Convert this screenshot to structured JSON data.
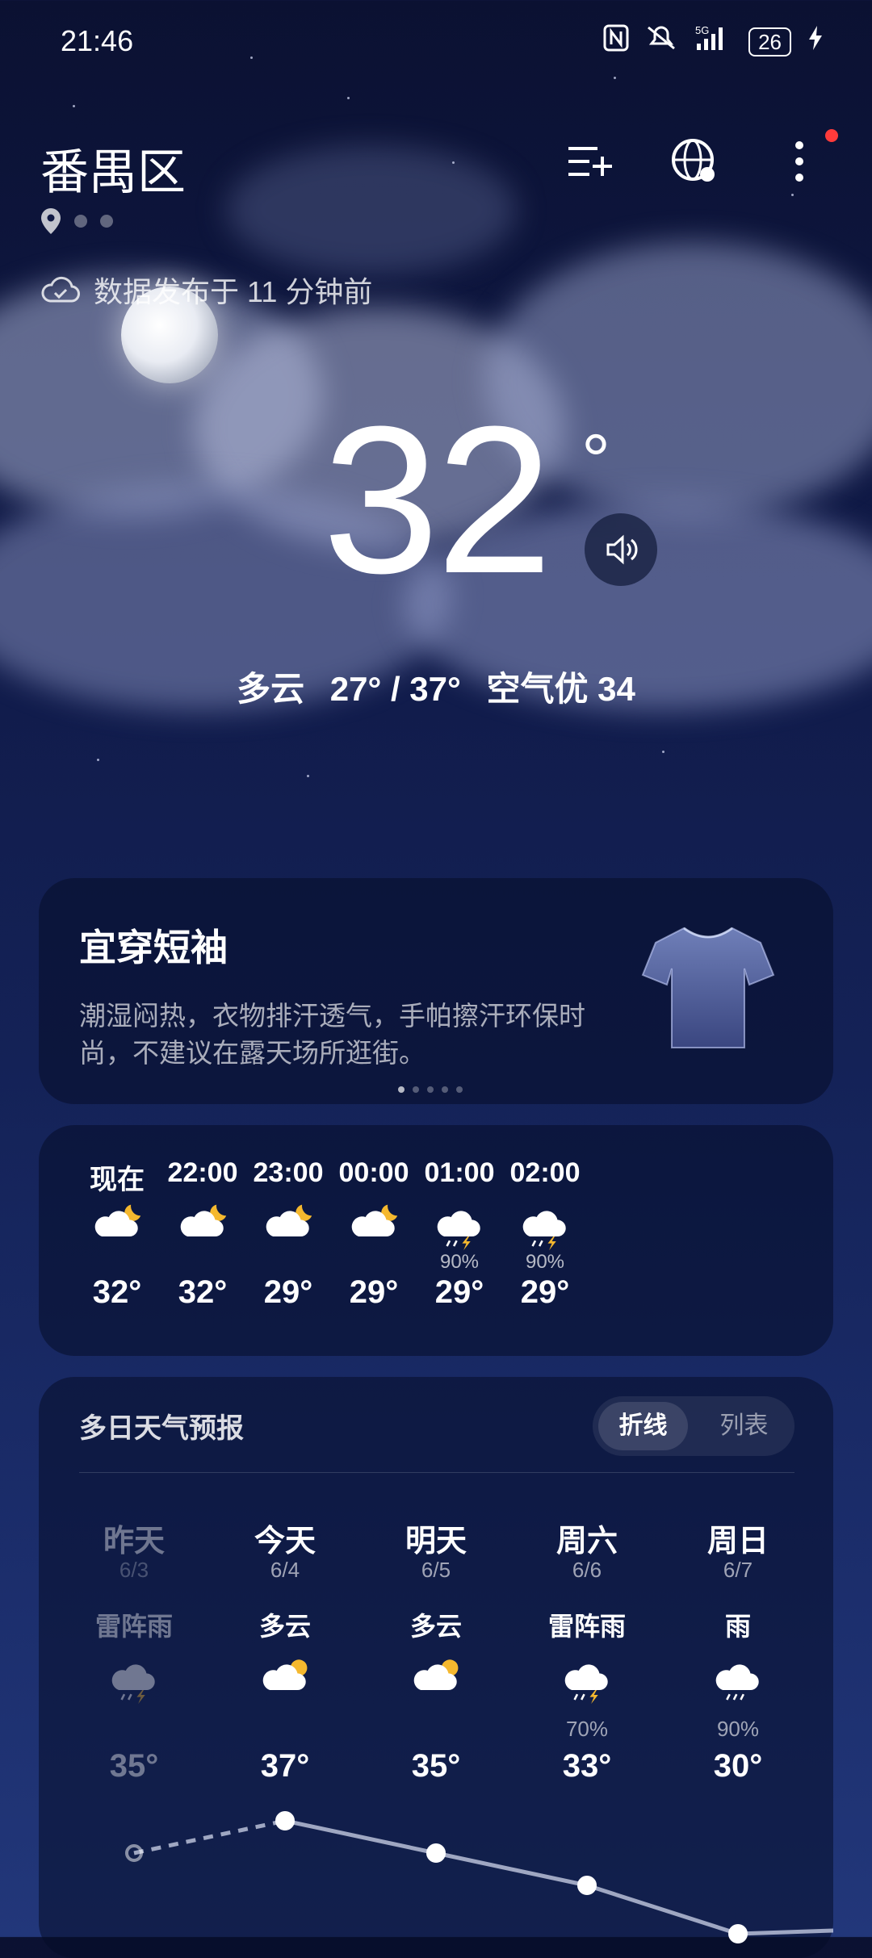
{
  "status_bar": {
    "time": "21:46",
    "battery": "26"
  },
  "header": {
    "city": "番禺区"
  },
  "published": "数据发布于 11 分钟前",
  "current": {
    "temperature": "32",
    "degree_symbol": "°",
    "condition": "多云",
    "range": "27° / 37°",
    "air_quality": "空气优 34"
  },
  "clothing_card": {
    "title": "宜穿短袖",
    "description": "潮湿闷热，衣物排汗透气，手帕擦汗环保时尚，不建议在露天场所逛街。"
  },
  "hourly": [
    {
      "time": "现在",
      "icon": "partly-cloudy-night-icon",
      "temp": "32°",
      "pop": ""
    },
    {
      "time": "22:00",
      "icon": "partly-cloudy-night-icon",
      "temp": "32°",
      "pop": ""
    },
    {
      "time": "23:00",
      "icon": "partly-cloudy-night-icon",
      "temp": "29°",
      "pop": ""
    },
    {
      "time": "00:00",
      "icon": "partly-cloudy-night-icon",
      "temp": "29°",
      "pop": ""
    },
    {
      "time": "01:00",
      "icon": "thunderstorm-icon",
      "temp": "29°",
      "pop": "90%"
    },
    {
      "time": "02:00",
      "icon": "thunderstorm-icon",
      "temp": "29°",
      "pop": "90%"
    }
  ],
  "forecast": {
    "title": "多日天气预报",
    "toggle": {
      "line": "折线",
      "list": "列表",
      "selected": "折线"
    },
    "days": [
      {
        "name": "昨天",
        "date": "6/3",
        "weather": "雷阵雨",
        "icon": "thunderstorm-icon",
        "pop": "",
        "high": "35°",
        "high_value": 35
      },
      {
        "name": "今天",
        "date": "6/4",
        "weather": "多云",
        "icon": "partly-cloudy-day-icon",
        "pop": "",
        "high": "37°",
        "high_value": 37
      },
      {
        "name": "明天",
        "date": "6/5",
        "weather": "多云",
        "icon": "partly-cloudy-day-icon",
        "pop": "",
        "high": "35°",
        "high_value": 35
      },
      {
        "name": "周六",
        "date": "6/6",
        "weather": "雷阵雨",
        "icon": "thunderstorm-icon",
        "pop": "70%",
        "high": "33°",
        "high_value": 33
      },
      {
        "name": "周日",
        "date": "6/7",
        "weather": "雨",
        "icon": "rain-icon",
        "pop": "90%",
        "high": "30°",
        "high_value": 30
      }
    ]
  },
  "colors": {
    "moon_accent": "#f5b82e",
    "lightning": "#f5b82e",
    "badge": "#ff3b3b"
  }
}
